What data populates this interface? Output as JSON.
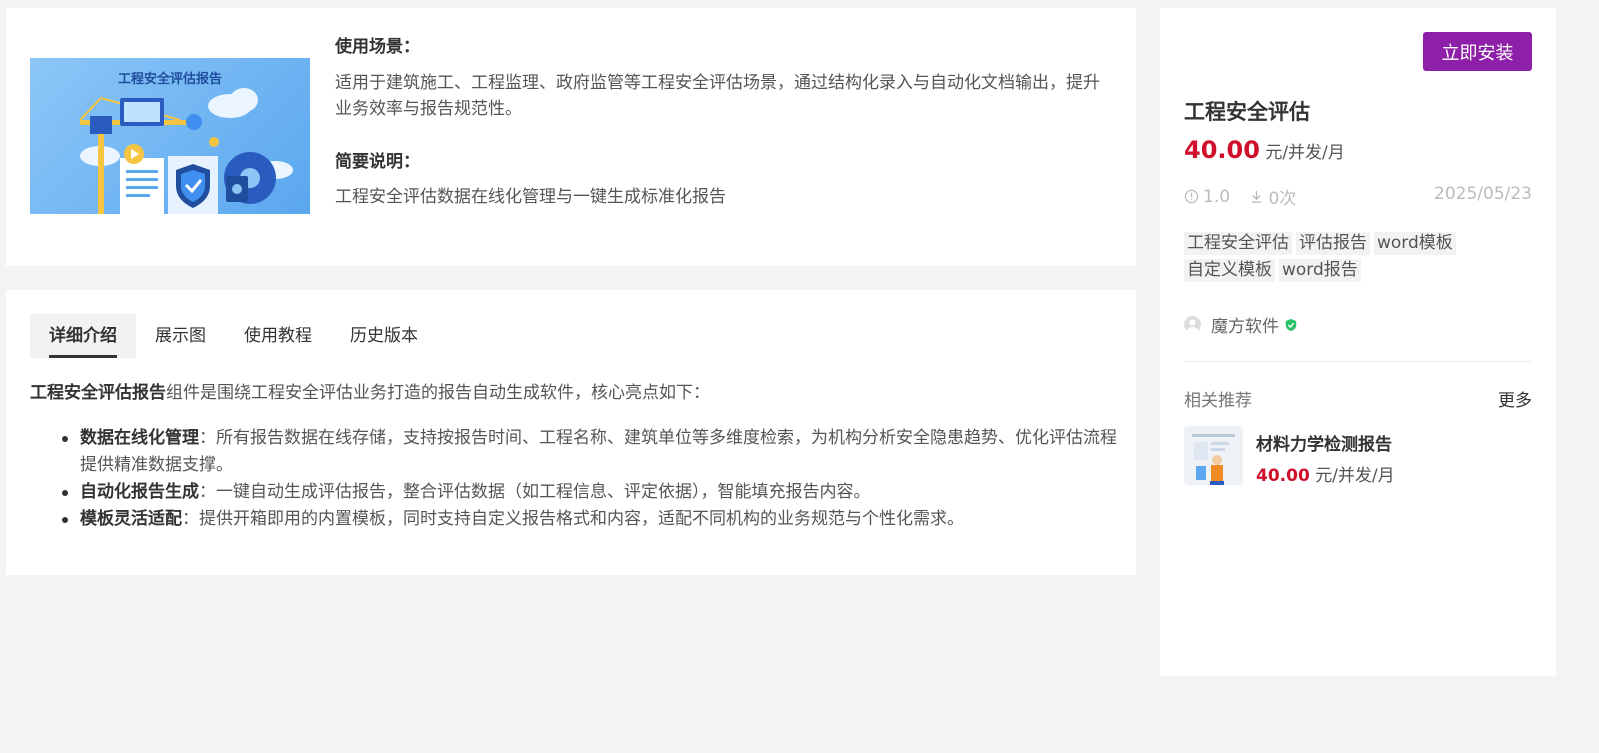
{
  "top": {
    "banner_title": "工程安全评估报告",
    "scene_label": "使用场景：",
    "scene_text": "适用于建筑施工、工程监理、政府监管等工程安全评估场景，通过结构化录入与自动化文档输出，提升业务效率与报告规范性。",
    "brief_label": "简要说明：",
    "brief_text": "工程安全评估数据在线化管理与一键生成标准化报告"
  },
  "tabs": [
    {
      "label": "详细介绍",
      "active": true
    },
    {
      "label": "展示图",
      "active": false
    },
    {
      "label": "使用教程",
      "active": false
    },
    {
      "label": "历史版本",
      "active": false
    }
  ],
  "detail": {
    "intro_bold": "工程安全评估报告",
    "intro_rest": "组件是围绕工程安全评估业务打造的报告自动生成软件，核心亮点如下：",
    "features": [
      {
        "title": "数据在线化管理",
        "text": "：所有报告数据在线存储，支持按报告时间、工程名称、建筑单位等多维度检索，为机构分析安全隐患趋势、优化评估流程提供精准数据支撑。"
      },
      {
        "title": "自动化报告生成",
        "text": "：一键自动生成评估报告，整合评估数据（如工程信息、评定依据），智能填充报告内容。"
      },
      {
        "title": "模板灵活适配",
        "text": "：提供开箱即用的内置模板，同时支持自定义报告格式和内容，适配不同机构的业务规范与个性化需求。"
      }
    ]
  },
  "side": {
    "install_label": "立即安装",
    "product_title": "工程安全评估",
    "price": "40.00",
    "price_unit": "元/并发/月",
    "version": "1.0",
    "downloads": "0次",
    "date": "2025/05/23",
    "tags": [
      "工程安全评估",
      "评估报告",
      "word模板",
      "自定义模板",
      "word报告"
    ],
    "vendor": "魔方软件",
    "rec_title": "相关推荐",
    "rec_more": "更多",
    "rec_items": [
      {
        "name": "材料力学检测报告",
        "price": "40.00",
        "unit": "元/并发/月"
      }
    ]
  },
  "colors": {
    "accent": "#8e1fa8",
    "price": "#d0102a",
    "verified": "#2bbf6a"
  }
}
